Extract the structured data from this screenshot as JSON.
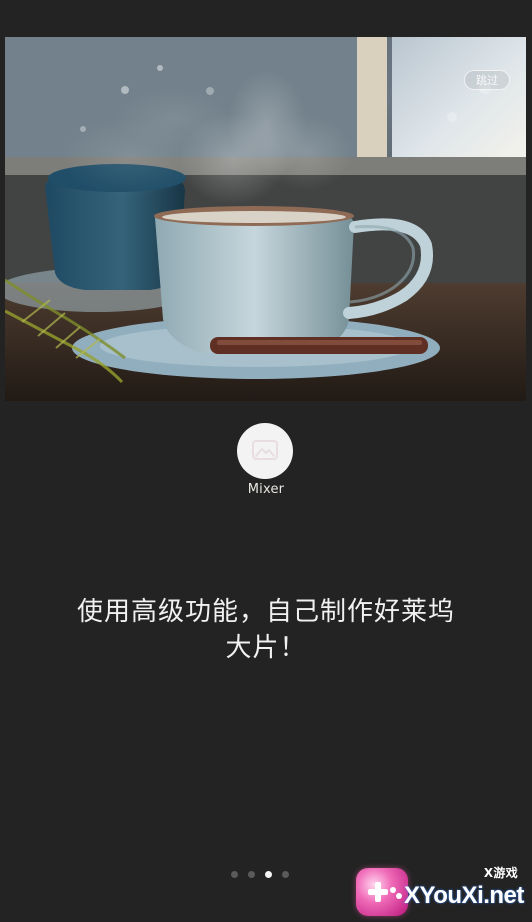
{
  "screen": {
    "skip_label": "跳过",
    "app_name": "Mixer",
    "tagline_line1": "使用高级功能，自己制作好莱坞",
    "tagline_line2": "大片！",
    "pager": {
      "total": 4,
      "active_index": 2
    }
  },
  "watermark": {
    "top_text": "X游戏",
    "main_text": "XYouXi.net"
  },
  "icons": {
    "app_logo": "photo-icon",
    "watermark_badge": "gamepad-icon"
  },
  "colors": {
    "background": "#232323",
    "text": "#f1f1f1",
    "dot_inactive": "#5a5a5a",
    "dot_active": "#f4f4f4",
    "logo_bg": "#f3f3f3"
  }
}
